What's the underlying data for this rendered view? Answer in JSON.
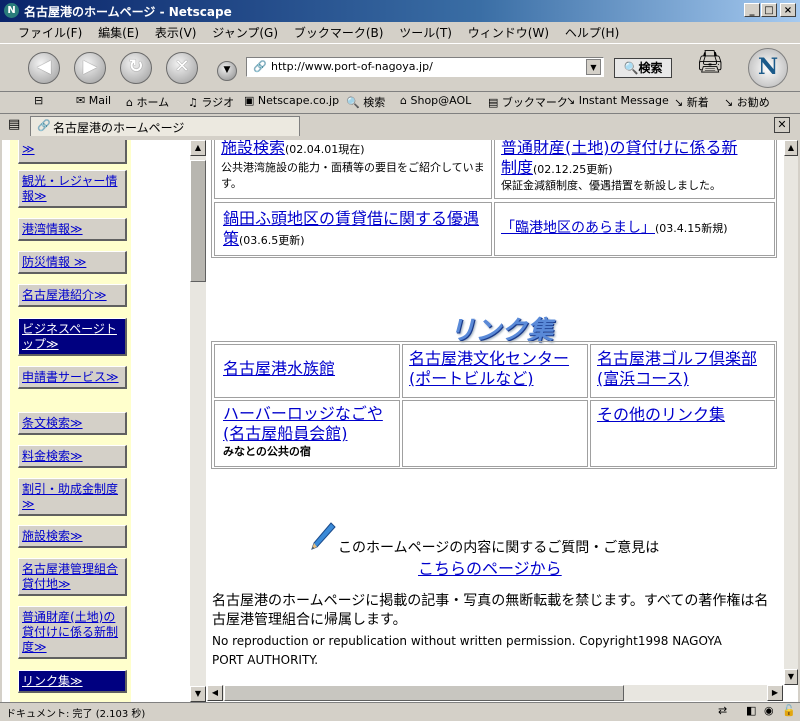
{
  "window": {
    "title": "名古屋港のホームページ - Netscape",
    "app_icon_letter": "N"
  },
  "menu": [
    "ファイル(F)",
    "編集(E)",
    "表示(V)",
    "ジャンプ(G)",
    "ブックマーク(B)",
    "ツール(T)",
    "ウィンドウ(W)",
    "ヘルプ(H)"
  ],
  "nav": {
    "url": "http://www.port-of-nagoya.jp/",
    "search_label": "検索"
  },
  "personal_toolbar": [
    "Mail",
    "ホーム",
    "ラジオ",
    "Netscape.co.jp",
    "検索",
    "Shop@AOL",
    "ブックマーク",
    "Instant Message",
    "新着",
    "お勧め"
  ],
  "tab": {
    "title": "名古屋港のホームページ"
  },
  "sidebar": {
    "items": [
      {
        "label": "≫"
      },
      {
        "label": "観光・レジャー情報≫"
      },
      {
        "label": "港湾情報≫"
      },
      {
        "label": "防災情報 ≫"
      },
      {
        "label": "名古屋港紹介≫"
      },
      {
        "label": "ビジネスページトップ≫"
      },
      {
        "label": "申請書サービス≫"
      },
      {
        "label": "条文検索≫"
      },
      {
        "label": "料金検索≫"
      },
      {
        "label": "割引・助成金制度≫"
      },
      {
        "label": "施設検索≫"
      },
      {
        "label": "名古屋港管理組合貸付地≫"
      },
      {
        "label": "普通財産(土地)の貸付けに係る新制度≫"
      },
      {
        "label": "リンク集≫"
      }
    ]
  },
  "main": {
    "row1_left_link": "施設検索",
    "row1_left_date": "(02.04.01現在)",
    "row1_left_desc": "公共港湾施設の能力・面積等の要目をご紹介しています。",
    "row1_right_link_a": "普通財産(土地)の貸付けに係る新",
    "row1_right_link_b": "制度",
    "row1_right_date": "(02.12.25更新)",
    "row1_right_desc": "保証金減額制度、優遇措置を新設しました。",
    "row2_left_link": "鍋田ふ頭地区の賃貸借に関する優遇策",
    "row2_left_date": "(03.6.5更新)",
    "row2_right_link": "「臨港地区のあらまし」",
    "row2_right_date": "(03.4.15新規)",
    "links_heading": "リンク集",
    "links": {
      "aquarium": "名古屋港水族館",
      "culture_center": "名古屋港文化センター(ポートビルなど)",
      "golf": "名古屋港ゴルフ倶楽部(富浜コース)",
      "harbor_lodge": "ハーバーロッジなごや(名古屋船員会館)",
      "harbor_lodge_sub": "みなとの公共の宿",
      "other": "その他のリンク集"
    },
    "contact_text": "このホームページの内容に関するご質問・ご意見は",
    "contact_link": "こちらのページから",
    "copyright_jp": "名古屋港のホームページに掲載の記事・写真の無断転載を禁じます。すべての著作権は名古屋港管理組合に帰属します。",
    "copyright_en": "No reproduction or republication without written permission. Copyright1998 NAGOYA PORT AUTHORITY."
  },
  "status": {
    "text": "ドキュメント: 完了 (2.103 秒)"
  }
}
